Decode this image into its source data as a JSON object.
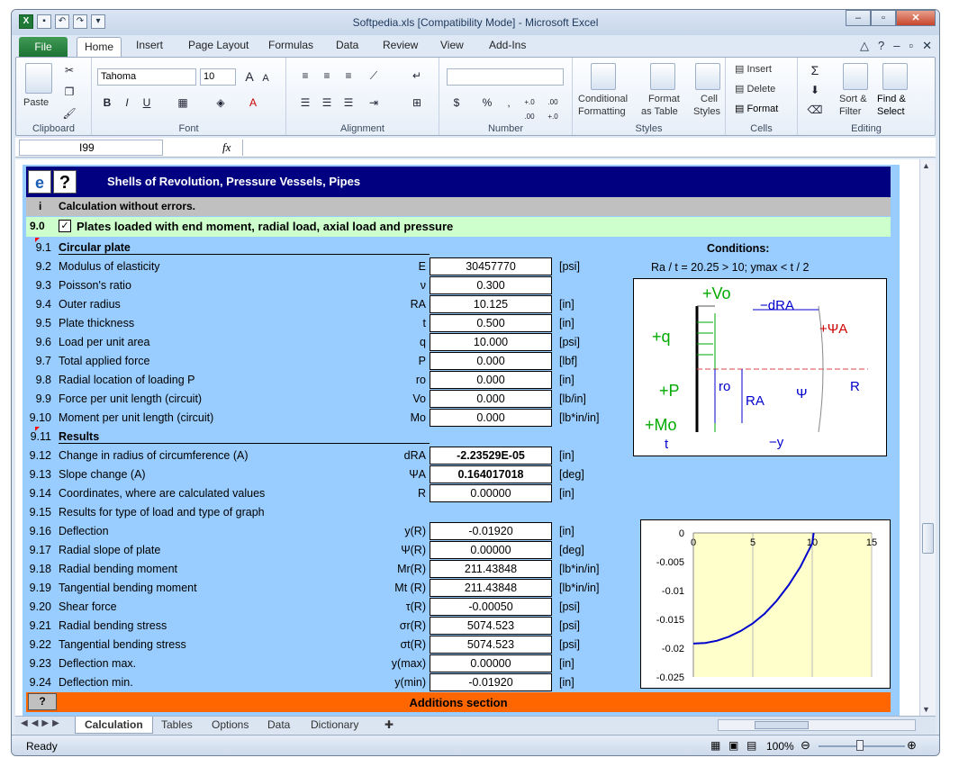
{
  "window": {
    "title": "Softpedia.xls  [Compatibility Mode]  -  Microsoft Excel",
    "watermark": "SOFTPEDIA"
  },
  "ribbon_tabs": [
    "File",
    "Home",
    "Insert",
    "Page Layout",
    "Formulas",
    "Data",
    "Review",
    "View",
    "Add-Ins"
  ],
  "ribbon": {
    "clipboard": {
      "label": "Clipboard",
      "paste": "Paste"
    },
    "font": {
      "label": "Font",
      "family": "Tahoma",
      "size": "10",
      "bold": "B",
      "italic": "I",
      "underline": "U",
      "grow": "A",
      "shrink": "A",
      "color": "A"
    },
    "alignment": {
      "label": "Alignment"
    },
    "number": {
      "label": "Number",
      "currency": "$",
      "percent": "%",
      "comma": ",",
      "inc": "+.0 .00",
      "dec": ".00 +.0"
    },
    "styles": {
      "label": "Styles",
      "conditional_1": "Conditional",
      "conditional_2": "Formatting",
      "format_table_1": "Format",
      "format_table_2": "as Table",
      "cell_styles_1": "Cell",
      "cell_styles_2": "Styles"
    },
    "cells": {
      "label": "Cells",
      "insert": "Insert",
      "delete": "Delete",
      "format": "Format"
    },
    "editing": {
      "label": "Editing",
      "sigma": "Σ",
      "sort_1": "Sort &",
      "sort_2": "Filter",
      "find_1": "Find &",
      "find_2": "Select"
    }
  },
  "formula_bar": {
    "name_box": "I99",
    "fx": "fx",
    "content": ""
  },
  "sheet": {
    "header_title": "Shells of Revolution, Pressure Vessels, Pipes",
    "header_icon_help": "?",
    "status_row": {
      "num": "i",
      "text": "Calculation without errors."
    },
    "section": {
      "num": "9.0",
      "check": "✓",
      "text": "Plates loaded with end moment, radial load, axial load and pressure"
    },
    "conditions_title": "Conditions:",
    "conditions_text": "Ra / t = 20.25 > 10;  ymax < t / 2",
    "rows": [
      {
        "num": "9.1",
        "label": "Circular plate",
        "sym": "",
        "value": "",
        "unit": "",
        "bold": true
      },
      {
        "num": "9.2",
        "label": "Modulus of elasticity",
        "sym": "E",
        "value": "30457770",
        "unit": "[psi]"
      },
      {
        "num": "9.3",
        "label": "Poisson's ratio",
        "sym": "ν",
        "value": "0.300",
        "unit": ""
      },
      {
        "num": "9.4",
        "label": "Outer radius",
        "sym": "RA",
        "value": "10.125",
        "unit": "[in]"
      },
      {
        "num": "9.5",
        "label": "Plate thickness",
        "sym": "t",
        "value": "0.500",
        "unit": "[in]"
      },
      {
        "num": "9.6",
        "label": "Load per unit area",
        "sym": "q",
        "value": "10.000",
        "unit": "[psi]"
      },
      {
        "num": "9.7",
        "label": "Total applied force",
        "sym": "P",
        "value": "0.000",
        "unit": "[lbf]"
      },
      {
        "num": "9.8",
        "label": "Radial location of loading P",
        "sym": "ro",
        "value": "0.000",
        "unit": "[in]"
      },
      {
        "num": "9.9",
        "label": "Force per unit length (circuit)",
        "sym": "Vo",
        "value": "0.000",
        "unit": "[lb/in]"
      },
      {
        "num": "9.10",
        "label": "Moment per unit length (circuit)",
        "sym": "Mo",
        "value": "0.000",
        "unit": "[lb*in/in]"
      },
      {
        "num": "9.11",
        "label": "Results",
        "sym": "",
        "value": "",
        "unit": "",
        "bold": true
      },
      {
        "num": "9.12",
        "label": "Change in radius of circumference (A)",
        "sym": "dRA",
        "value": "-2.23529E-05",
        "unit": "[in]",
        "vbold": true
      },
      {
        "num": "9.13",
        "label": "Slope change (A)",
        "sym": "ΨA",
        "value": "0.164017018",
        "unit": "[deg]",
        "vbold": true
      },
      {
        "num": "9.14",
        "label": "Coordinates, where are calculated values",
        "sym": "R",
        "value": "0.00000",
        "unit": "[in]"
      },
      {
        "num": "9.15",
        "label": "Results for type of load and type of graph",
        "sym": "",
        "value": "",
        "unit": ""
      },
      {
        "num": "9.16",
        "label": "Deflection",
        "sym": "y(R)",
        "value": "-0.01920",
        "unit": "[in]"
      },
      {
        "num": "9.17",
        "label": "Radial slope of plate",
        "sym": "Ψ(R)",
        "value": "0.00000",
        "unit": "[deg]"
      },
      {
        "num": "9.18",
        "label": "Radial bending moment",
        "sym": "Mr(R)",
        "value": "211.43848",
        "unit": "[lb*in/in]"
      },
      {
        "num": "9.19",
        "label": "Tangential bending moment",
        "sym": "Mt (R)",
        "value": "211.43848",
        "unit": "[lb*in/in]"
      },
      {
        "num": "9.20",
        "label": "Shear force",
        "sym": "τ(R)",
        "value": "-0.00050",
        "unit": "[psi]"
      },
      {
        "num": "9.21",
        "label": "Radial bending stress",
        "sym": "σr(R)",
        "value": "5074.523",
        "unit": "[psi]"
      },
      {
        "num": "9.22",
        "label": "Tangential bending stress",
        "sym": "σt(R)",
        "value": "5074.523",
        "unit": "[psi]"
      },
      {
        "num": "9.23",
        "label": "Deflection max.",
        "sym": "y(max)",
        "value": "0.00000",
        "unit": "[in]"
      },
      {
        "num": "9.24",
        "label": "Deflection min.",
        "sym": "y(min)",
        "value": "-0.01920",
        "unit": "[in]"
      }
    ],
    "additions": {
      "icon": "?",
      "text": "Additions section"
    },
    "diagram_labels": {
      "vo": "+Vo",
      "dra": "−dRA",
      "q": "+q",
      "psia": "+ΨA",
      "p": "+P",
      "ro": "ro",
      "ra": "RA",
      "psi": "Ψ",
      "r": "R",
      "mo": "+Mo",
      "t": "t",
      "y": "−y"
    }
  },
  "chart_data": {
    "type": "line",
    "x": [
      0,
      1,
      2,
      3,
      4,
      5,
      6,
      7,
      8,
      9,
      10,
      10.125
    ],
    "y": [
      -0.0192,
      -0.0191,
      -0.0187,
      -0.018,
      -0.017,
      -0.0157,
      -0.014,
      -0.0118,
      -0.0091,
      -0.0059,
      -0.0018,
      0.0
    ],
    "xticks": [
      "0",
      "5",
      "10",
      "15"
    ],
    "yticks": [
      "0",
      "-0.005",
      "-0.01",
      "-0.015",
      "-0.02",
      "-0.025"
    ],
    "xlim": [
      0,
      15
    ],
    "ylim": [
      -0.025,
      0
    ],
    "line_color": "#0000cc",
    "plot_bg": "#ffffcc"
  },
  "sheet_tabs": [
    "Calculation",
    "Tables",
    "Options",
    "Data",
    "Dictionary"
  ],
  "status": {
    "ready": "Ready",
    "zoom": "100%"
  }
}
